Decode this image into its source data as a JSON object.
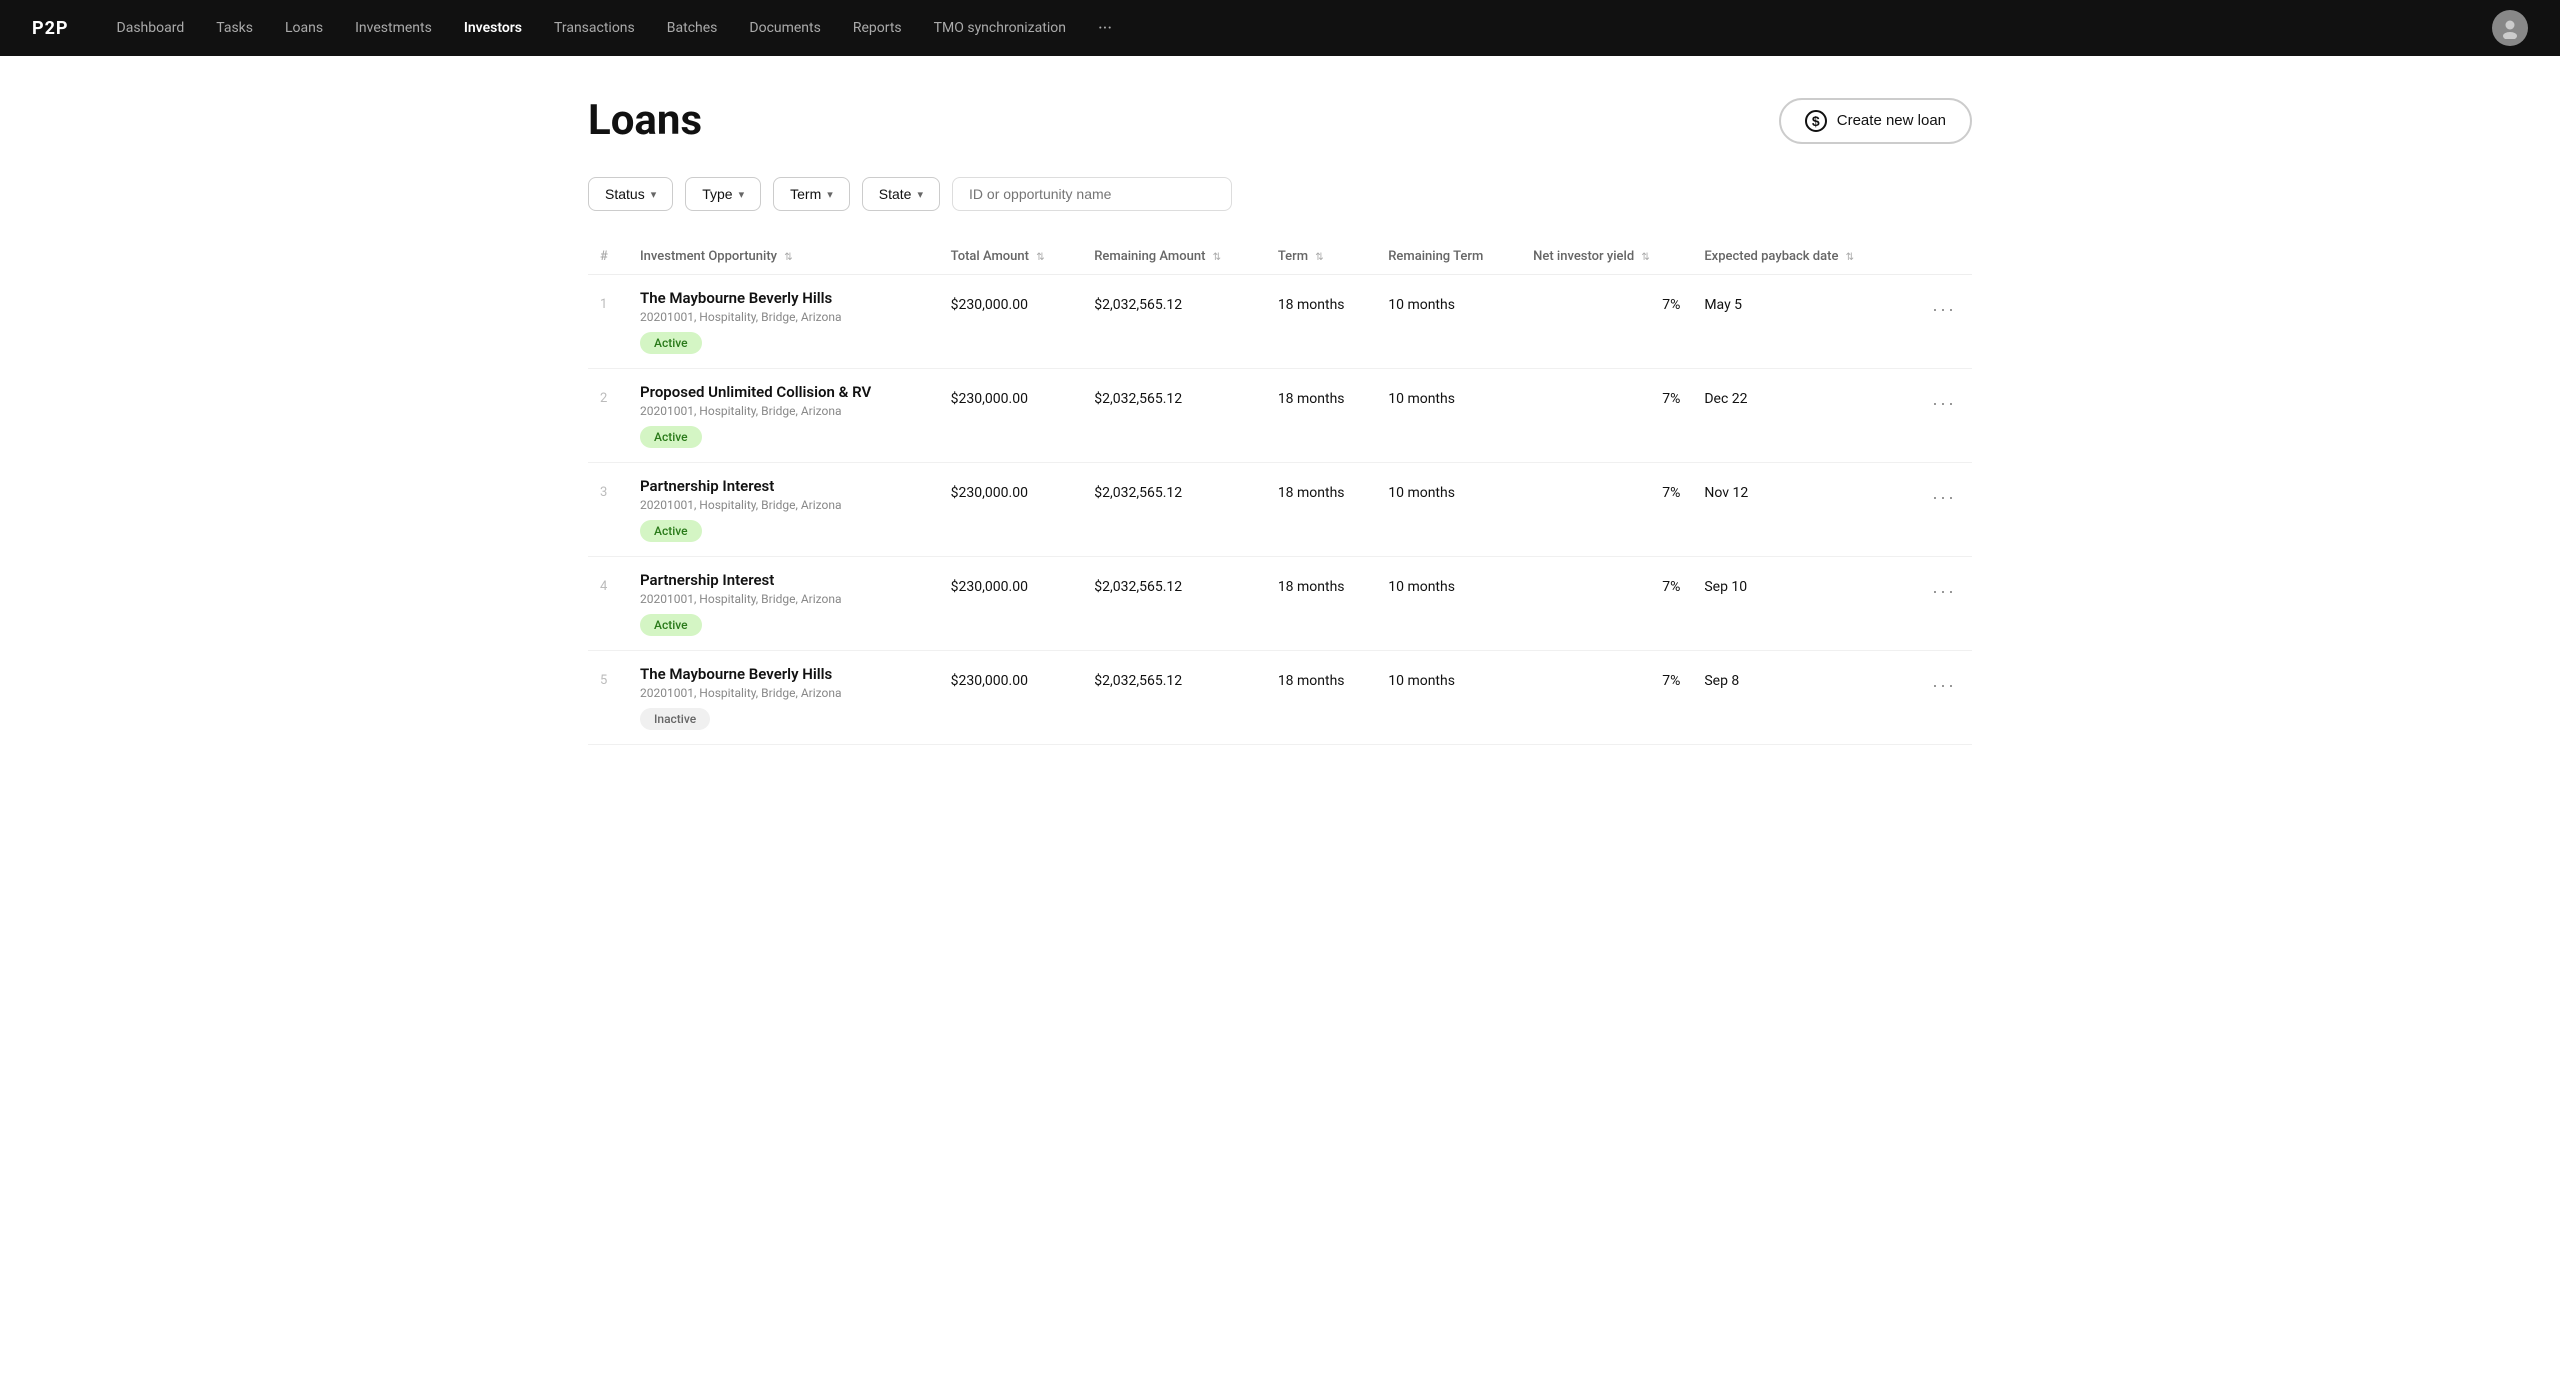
{
  "nav": {
    "logo": "P2P",
    "links": [
      {
        "label": "Dashboard",
        "active": false
      },
      {
        "label": "Tasks",
        "active": false
      },
      {
        "label": "Loans",
        "active": false
      },
      {
        "label": "Investments",
        "active": false
      },
      {
        "label": "Investors",
        "active": true
      },
      {
        "label": "Transactions",
        "active": false
      },
      {
        "label": "Batches",
        "active": false
      },
      {
        "label": "Documents",
        "active": false
      },
      {
        "label": "Reports",
        "active": false
      },
      {
        "label": "TMO synchronization",
        "active": false
      }
    ],
    "more_label": "···",
    "avatar_initial": "👤"
  },
  "page": {
    "title": "Loans",
    "create_button": "Create new loan"
  },
  "filters": {
    "status_label": "Status",
    "type_label": "Type",
    "term_label": "Term",
    "state_label": "State",
    "search_placeholder": "ID or opportunity name"
  },
  "table": {
    "columns": [
      {
        "key": "num",
        "label": "#",
        "sortable": false
      },
      {
        "key": "opportunity",
        "label": "Investment Opportunity",
        "sortable": true
      },
      {
        "key": "total_amount",
        "label": "Total Amount",
        "sortable": true
      },
      {
        "key": "remaining_amount",
        "label": "Remaining Amount",
        "sortable": true
      },
      {
        "key": "term",
        "label": "Term",
        "sortable": true
      },
      {
        "key": "remaining_term",
        "label": "Remaining Term",
        "sortable": false
      },
      {
        "key": "net_yield",
        "label": "Net investor yield",
        "sortable": true
      },
      {
        "key": "payback_date",
        "label": "Expected payback date",
        "sortable": true
      }
    ],
    "rows": [
      {
        "num": "1",
        "name": "The Maybourne Beverly Hills",
        "meta": "20201001, Hospitality, Bridge, Arizona",
        "status": "Active",
        "status_type": "active",
        "total_amount": "$230,000.00",
        "remaining_amount": "$2,032,565.12",
        "term": "18 months",
        "remaining_term": "10 months",
        "net_yield": "7%",
        "payback_date": "May 5"
      },
      {
        "num": "2",
        "name": "Proposed Unlimited Collision & RV",
        "meta": "20201001, Hospitality, Bridge, Arizona",
        "status": "Active",
        "status_type": "active",
        "total_amount": "$230,000.00",
        "remaining_amount": "$2,032,565.12",
        "term": "18 months",
        "remaining_term": "10 months",
        "net_yield": "7%",
        "payback_date": "Dec 22"
      },
      {
        "num": "3",
        "name": "Partnership Interest",
        "meta": "20201001, Hospitality, Bridge, Arizona",
        "status": "Active",
        "status_type": "active",
        "total_amount": "$230,000.00",
        "remaining_amount": "$2,032,565.12",
        "term": "18 months",
        "remaining_term": "10 months",
        "net_yield": "7%",
        "payback_date": "Nov 12"
      },
      {
        "num": "4",
        "name": "Partnership Interest",
        "meta": "20201001, Hospitality, Bridge, Arizona",
        "status": "Active",
        "status_type": "active",
        "total_amount": "$230,000.00",
        "remaining_amount": "$2,032,565.12",
        "term": "18 months",
        "remaining_term": "10 months",
        "net_yield": "7%",
        "payback_date": "Sep 10"
      },
      {
        "num": "5",
        "name": "The Maybourne Beverly Hills",
        "meta": "20201001, Hospitality, Bridge, Arizona",
        "status": "Inactive",
        "status_type": "inactive",
        "total_amount": "$230,000.00",
        "remaining_amount": "$2,032,565.12",
        "term": "18 months",
        "remaining_term": "10 months",
        "net_yield": "7%",
        "payback_date": "Sep 8"
      }
    ]
  }
}
